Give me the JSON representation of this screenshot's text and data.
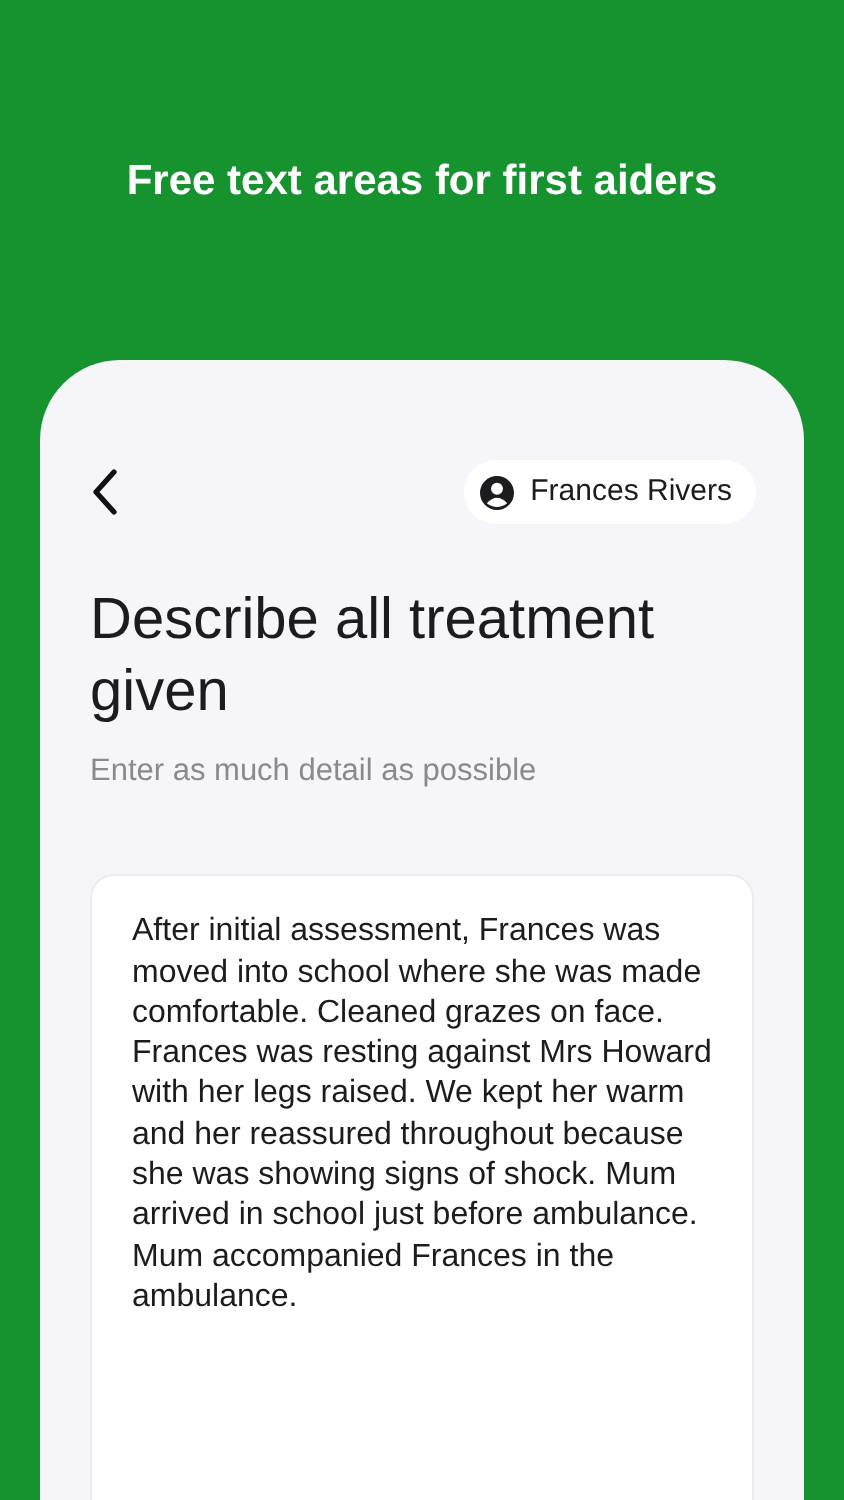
{
  "headline": "Free text areas for first aiders",
  "top_bar": {
    "patient": "Frances Rivers"
  },
  "question": {
    "title": "Describe all treatment given",
    "subtitle": "Enter as much detail as possible"
  },
  "answer": {
    "value": "After initial assessment, Frances was moved into school where she was made comfortable. Cleaned grazes on face. Frances was resting against Mrs Howard with her legs raised. We kept her warm and her reassured throughout because she was showing signs of shock. Mum arrived in school just before ambulance. Mum accompanied Frances in the ambulance."
  }
}
